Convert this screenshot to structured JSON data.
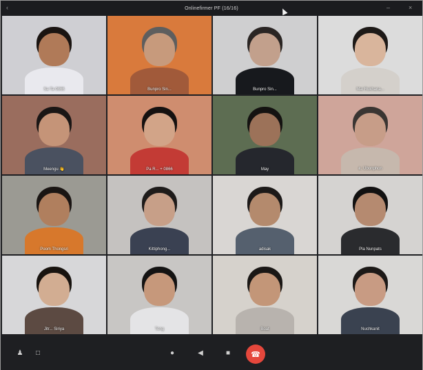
{
  "window": {
    "title": "Onlinefirmer PF (16/16)"
  },
  "tiles": [
    {
      "name": "Sa Ta 0866",
      "bg": "#cfcfd3",
      "skin": "#b07a58",
      "hair": "#1a1411",
      "shirt": "#e9e9ee"
    },
    {
      "name": "Bunpro Sin...",
      "bg": "#d97a3c",
      "skin": "#c79a7c",
      "hair": "#5e5e5e",
      "shirt": "#a15a3a"
    },
    {
      "name": "Bunpro Sin...",
      "bg": "#cfcfd0",
      "skin": "#c2a08c",
      "hair": "#2a2523",
      "shirt": "#17191d"
    },
    {
      "name": "Mai Rukhana...",
      "bg": "#dcdcdc",
      "skin": "#d9b59c",
      "hair": "#1d1917",
      "shirt": "#d4d0cb"
    },
    {
      "name": "Meengu 👋",
      "bg": "#9a6d5e",
      "skin": "#c59478",
      "hair": "#1a1615",
      "shirt": "#4a5160"
    },
    {
      "name": "Pa R... + 0866",
      "bg": "#cf8d6f",
      "skin": "#d2a488",
      "hair": "#151110",
      "shirt": "#c33b35"
    },
    {
      "name": "May",
      "bg": "#5d6d52",
      "skin": "#9c7259",
      "hair": "#141211",
      "shirt": "#25272d"
    },
    {
      "name": "อ. Ubonphon",
      "bg": "#cfa59a",
      "skin": "#c79d88",
      "hair": "#3a3532",
      "shirt": "#c6b8ad"
    },
    {
      "name": "Poom Thongsri",
      "bg": "#9b9a93",
      "skin": "#b07f5e",
      "hair": "#1a1513",
      "shirt": "#d7782c"
    },
    {
      "name": "Kittiphong...",
      "bg": "#c5c2c0",
      "skin": "#c79f88",
      "hair": "#1e1b1a",
      "shirt": "#3a4152"
    },
    {
      "name": "adisak",
      "bg": "#d9d6d3",
      "skin": "#b48a6d",
      "hair": "#1c1918",
      "shirt": "#55606e"
    },
    {
      "name": "Pla Nunpats",
      "bg": "#d5d3d1",
      "skin": "#b58a70",
      "hair": "#121111",
      "shirt": "#2a2b2e"
    },
    {
      "name": "Jitr... Siriya",
      "bg": "#d7d7d9",
      "skin": "#d2ad92",
      "hair": "#18130f",
      "shirt": "#5c4a42"
    },
    {
      "name": "Tong",
      "bg": "#c8c6c4",
      "skin": "#c6987b",
      "hair": "#141313",
      "shirt": "#e4e4e6"
    },
    {
      "name": "Boat",
      "bg": "#d6d2cc",
      "skin": "#c39678",
      "hair": "#1a1715",
      "shirt": "#b8b3ae"
    },
    {
      "name": "Nuchkanit",
      "bg": "#d9d8d6",
      "skin": "#c89b83",
      "hair": "#1c1917",
      "shirt": "#3a4250"
    }
  ],
  "controls": {
    "end_call_color": "#e5473c"
  }
}
